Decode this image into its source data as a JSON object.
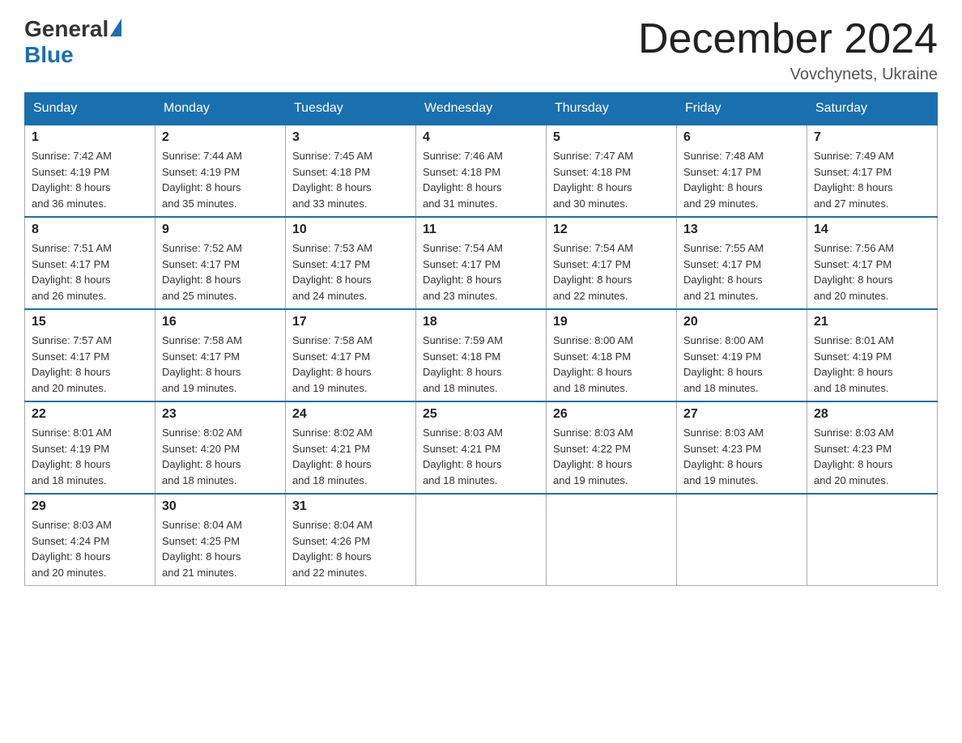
{
  "header": {
    "logo_general": "General",
    "logo_blue": "Blue",
    "month_title": "December 2024",
    "location": "Vovchynets, Ukraine"
  },
  "weekdays": [
    "Sunday",
    "Monday",
    "Tuesday",
    "Wednesday",
    "Thursday",
    "Friday",
    "Saturday"
  ],
  "weeks": [
    [
      {
        "day": "1",
        "sunrise": "7:42 AM",
        "sunset": "4:19 PM",
        "daylight": "8 hours and 36 minutes."
      },
      {
        "day": "2",
        "sunrise": "7:44 AM",
        "sunset": "4:19 PM",
        "daylight": "8 hours and 35 minutes."
      },
      {
        "day": "3",
        "sunrise": "7:45 AM",
        "sunset": "4:18 PM",
        "daylight": "8 hours and 33 minutes."
      },
      {
        "day": "4",
        "sunrise": "7:46 AM",
        "sunset": "4:18 PM",
        "daylight": "8 hours and 31 minutes."
      },
      {
        "day": "5",
        "sunrise": "7:47 AM",
        "sunset": "4:18 PM",
        "daylight": "8 hours and 30 minutes."
      },
      {
        "day": "6",
        "sunrise": "7:48 AM",
        "sunset": "4:17 PM",
        "daylight": "8 hours and 29 minutes."
      },
      {
        "day": "7",
        "sunrise": "7:49 AM",
        "sunset": "4:17 PM",
        "daylight": "8 hours and 27 minutes."
      }
    ],
    [
      {
        "day": "8",
        "sunrise": "7:51 AM",
        "sunset": "4:17 PM",
        "daylight": "8 hours and 26 minutes."
      },
      {
        "day": "9",
        "sunrise": "7:52 AM",
        "sunset": "4:17 PM",
        "daylight": "8 hours and 25 minutes."
      },
      {
        "day": "10",
        "sunrise": "7:53 AM",
        "sunset": "4:17 PM",
        "daylight": "8 hours and 24 minutes."
      },
      {
        "day": "11",
        "sunrise": "7:54 AM",
        "sunset": "4:17 PM",
        "daylight": "8 hours and 23 minutes."
      },
      {
        "day": "12",
        "sunrise": "7:54 AM",
        "sunset": "4:17 PM",
        "daylight": "8 hours and 22 minutes."
      },
      {
        "day": "13",
        "sunrise": "7:55 AM",
        "sunset": "4:17 PM",
        "daylight": "8 hours and 21 minutes."
      },
      {
        "day": "14",
        "sunrise": "7:56 AM",
        "sunset": "4:17 PM",
        "daylight": "8 hours and 20 minutes."
      }
    ],
    [
      {
        "day": "15",
        "sunrise": "7:57 AM",
        "sunset": "4:17 PM",
        "daylight": "8 hours and 20 minutes."
      },
      {
        "day": "16",
        "sunrise": "7:58 AM",
        "sunset": "4:17 PM",
        "daylight": "8 hours and 19 minutes."
      },
      {
        "day": "17",
        "sunrise": "7:58 AM",
        "sunset": "4:17 PM",
        "daylight": "8 hours and 19 minutes."
      },
      {
        "day": "18",
        "sunrise": "7:59 AM",
        "sunset": "4:18 PM",
        "daylight": "8 hours and 18 minutes."
      },
      {
        "day": "19",
        "sunrise": "8:00 AM",
        "sunset": "4:18 PM",
        "daylight": "8 hours and 18 minutes."
      },
      {
        "day": "20",
        "sunrise": "8:00 AM",
        "sunset": "4:19 PM",
        "daylight": "8 hours and 18 minutes."
      },
      {
        "day": "21",
        "sunrise": "8:01 AM",
        "sunset": "4:19 PM",
        "daylight": "8 hours and 18 minutes."
      }
    ],
    [
      {
        "day": "22",
        "sunrise": "8:01 AM",
        "sunset": "4:19 PM",
        "daylight": "8 hours and 18 minutes."
      },
      {
        "day": "23",
        "sunrise": "8:02 AM",
        "sunset": "4:20 PM",
        "daylight": "8 hours and 18 minutes."
      },
      {
        "day": "24",
        "sunrise": "8:02 AM",
        "sunset": "4:21 PM",
        "daylight": "8 hours and 18 minutes."
      },
      {
        "day": "25",
        "sunrise": "8:03 AM",
        "sunset": "4:21 PM",
        "daylight": "8 hours and 18 minutes."
      },
      {
        "day": "26",
        "sunrise": "8:03 AM",
        "sunset": "4:22 PM",
        "daylight": "8 hours and 19 minutes."
      },
      {
        "day": "27",
        "sunrise": "8:03 AM",
        "sunset": "4:23 PM",
        "daylight": "8 hours and 19 minutes."
      },
      {
        "day": "28",
        "sunrise": "8:03 AM",
        "sunset": "4:23 PM",
        "daylight": "8 hours and 20 minutes."
      }
    ],
    [
      {
        "day": "29",
        "sunrise": "8:03 AM",
        "sunset": "4:24 PM",
        "daylight": "8 hours and 20 minutes."
      },
      {
        "day": "30",
        "sunrise": "8:04 AM",
        "sunset": "4:25 PM",
        "daylight": "8 hours and 21 minutes."
      },
      {
        "day": "31",
        "sunrise": "8:04 AM",
        "sunset": "4:26 PM",
        "daylight": "8 hours and 22 minutes."
      },
      null,
      null,
      null,
      null
    ]
  ],
  "labels": {
    "sunrise": "Sunrise:",
    "sunset": "Sunset:",
    "daylight": "Daylight:"
  }
}
